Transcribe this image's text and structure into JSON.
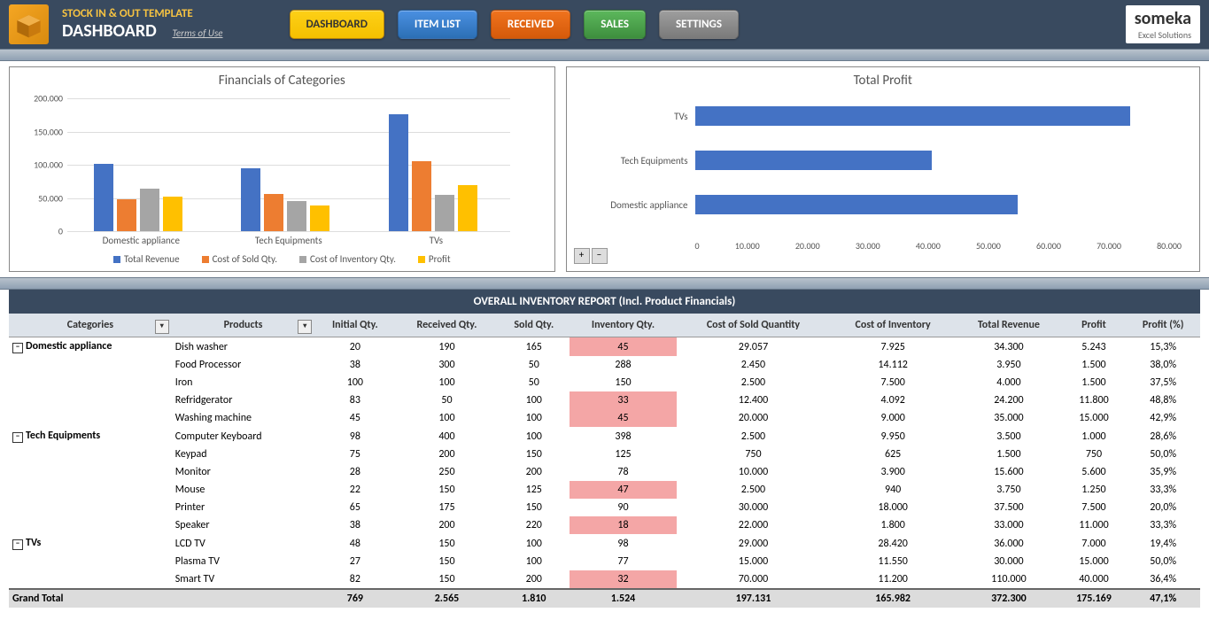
{
  "header": {
    "app_title": "STOCK IN & OUT TEMPLATE",
    "page_title": "DASHBOARD",
    "terms": "Terms of Use",
    "nav": [
      "DASHBOARD",
      "ITEM LIST",
      "RECEIVED",
      "SALES",
      "SETTINGS"
    ],
    "brand_name": "someka",
    "brand_sub": "Excel Solutions"
  },
  "report_header": "OVERALL INVENTORY REPORT (Incl. Product Financials)",
  "table": {
    "columns": [
      "Categories",
      "Products",
      "Initial Qty.",
      "Received Qty.",
      "Sold Qty.",
      "Inventory Qty.",
      "Cost of Sold Quantity",
      "Cost of Inventory",
      "Total Revenue",
      "Profit",
      "Profit (%)"
    ],
    "rows": [
      {
        "cat": "Domestic appliance",
        "prod": "Dish washer",
        "iq": "20",
        "rq": "190",
        "sq": "165",
        "inv": "45",
        "low": true,
        "csq": "29.057",
        "ci": "7.925",
        "tr": "34.300",
        "pr": "5.243",
        "pp": "15,3%"
      },
      {
        "cat": "",
        "prod": "Food Processor",
        "iq": "38",
        "rq": "300",
        "sq": "50",
        "inv": "288",
        "low": false,
        "csq": "2.450",
        "ci": "14.112",
        "tr": "3.950",
        "pr": "1.500",
        "pp": "38,0%"
      },
      {
        "cat": "",
        "prod": "Iron",
        "iq": "100",
        "rq": "100",
        "sq": "50",
        "inv": "150",
        "low": false,
        "csq": "2.500",
        "ci": "7.500",
        "tr": "4.000",
        "pr": "1.500",
        "pp": "37,5%"
      },
      {
        "cat": "",
        "prod": "Refridgerator",
        "iq": "83",
        "rq": "50",
        "sq": "100",
        "inv": "33",
        "low": true,
        "csq": "12.400",
        "ci": "4.092",
        "tr": "24.200",
        "pr": "11.800",
        "pp": "48,8%"
      },
      {
        "cat": "",
        "prod": "Washing machine",
        "iq": "45",
        "rq": "100",
        "sq": "100",
        "inv": "45",
        "low": true,
        "csq": "20.000",
        "ci": "9.000",
        "tr": "35.000",
        "pr": "15.000",
        "pp": "42,9%"
      },
      {
        "cat": "Tech Equipments",
        "prod": "Computer Keyboard",
        "iq": "98",
        "rq": "400",
        "sq": "100",
        "inv": "398",
        "low": false,
        "csq": "2.500",
        "ci": "9.950",
        "tr": "3.500",
        "pr": "1.000",
        "pp": "28,6%"
      },
      {
        "cat": "",
        "prod": "Keypad",
        "iq": "75",
        "rq": "200",
        "sq": "150",
        "inv": "125",
        "low": false,
        "csq": "750",
        "ci": "625",
        "tr": "1.500",
        "pr": "750",
        "pp": "50,0%"
      },
      {
        "cat": "",
        "prod": "Monitor",
        "iq": "28",
        "rq": "250",
        "sq": "200",
        "inv": "78",
        "low": false,
        "csq": "10.000",
        "ci": "3.900",
        "tr": "15.600",
        "pr": "5.600",
        "pp": "35,9%"
      },
      {
        "cat": "",
        "prod": "Mouse",
        "iq": "22",
        "rq": "150",
        "sq": "125",
        "inv": "47",
        "low": true,
        "csq": "2.500",
        "ci": "940",
        "tr": "3.750",
        "pr": "1.250",
        "pp": "33,3%"
      },
      {
        "cat": "",
        "prod": "Printer",
        "iq": "65",
        "rq": "175",
        "sq": "150",
        "inv": "90",
        "low": false,
        "csq": "30.000",
        "ci": "18.000",
        "tr": "37.500",
        "pr": "7.500",
        "pp": "20,0%"
      },
      {
        "cat": "",
        "prod": "Speaker",
        "iq": "38",
        "rq": "200",
        "sq": "220",
        "inv": "18",
        "low": true,
        "csq": "22.000",
        "ci": "1.800",
        "tr": "33.000",
        "pr": "11.000",
        "pp": "33,3%"
      },
      {
        "cat": "TVs",
        "prod": "LCD TV",
        "iq": "48",
        "rq": "150",
        "sq": "100",
        "inv": "98",
        "low": false,
        "csq": "29.000",
        "ci": "28.420",
        "tr": "36.000",
        "pr": "7.000",
        "pp": "19,4%"
      },
      {
        "cat": "",
        "prod": "Plasma TV",
        "iq": "27",
        "rq": "150",
        "sq": "100",
        "inv": "77",
        "low": false,
        "csq": "15.000",
        "ci": "11.550",
        "tr": "30.000",
        "pr": "15.000",
        "pp": "50,0%"
      },
      {
        "cat": "",
        "prod": "Smart TV",
        "iq": "82",
        "rq": "150",
        "sq": "200",
        "inv": "32",
        "low": true,
        "csq": "70.000",
        "ci": "11.200",
        "tr": "110.000",
        "pr": "40.000",
        "pp": "36,4%"
      }
    ],
    "total": {
      "cat": "Grand Total",
      "iq": "769",
      "rq": "2.565",
      "sq": "1.810",
      "inv": "1.524",
      "csq": "197.131",
      "ci": "165.982",
      "tr": "372.300",
      "pr": "175.169",
      "pp": "47,1%"
    }
  },
  "chart_data": [
    {
      "type": "bar",
      "title": "Financials of Categories",
      "categories": [
        "Domestic appliance",
        "Tech Equipments",
        "TVs"
      ],
      "series": [
        {
          "name": "Total Revenue",
          "values": [
            101450,
            95000,
            176000
          ]
        },
        {
          "name": "Cost of Sold Qty.",
          "values": [
            48000,
            56000,
            106000
          ]
        },
        {
          "name": "Cost of Inventory Qty.",
          "values": [
            64000,
            45000,
            55000
          ]
        },
        {
          "name": "Profit",
          "values": [
            52000,
            39000,
            70000
          ]
        }
      ],
      "ylabel": "",
      "xlabel": "",
      "ylim": [
        0,
        200000
      ],
      "yticks": [
        "0",
        "50.000",
        "100.000",
        "150.000",
        "200.000"
      ]
    },
    {
      "type": "bar",
      "orientation": "horizontal",
      "title": "Total Profit",
      "categories": [
        "TVs",
        "Tech Equipments",
        "Domestic appliance"
      ],
      "values": [
        71500,
        39000,
        53000
      ],
      "xlim": [
        0,
        80000
      ],
      "xticks": [
        "0",
        "10.000",
        "20.000",
        "30.000",
        "40.000",
        "50.000",
        "60.000",
        "70.000",
        "80.000"
      ]
    }
  ]
}
